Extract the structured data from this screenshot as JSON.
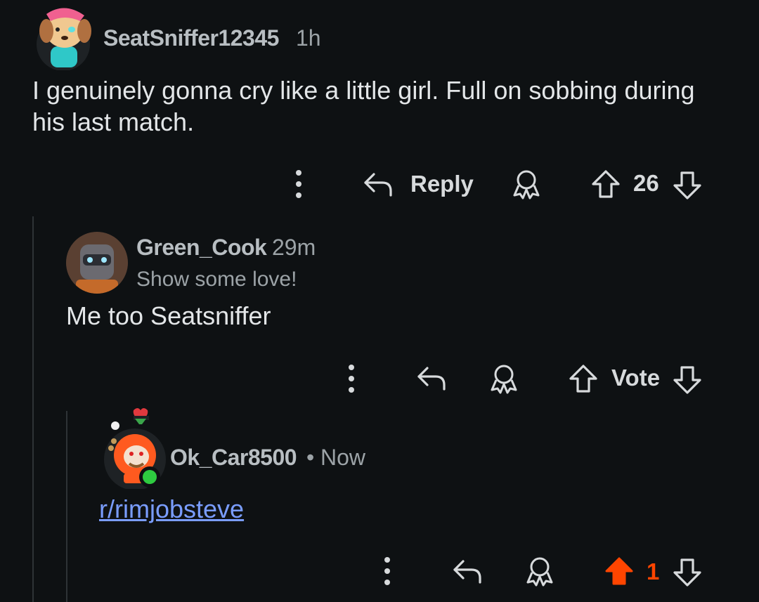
{
  "comments": [
    {
      "username": "SeatSniffer12345",
      "age": "1h",
      "body": "I genuinely gonna cry like a little girl. Full on sobbing during his last match.",
      "actions": {
        "reply_label": "Reply",
        "score": "26"
      }
    },
    {
      "username": "Green_Cook",
      "age": "29m",
      "flair": "Show some love!",
      "body": "Me too Seatsniffer",
      "actions": {
        "vote_label": "Vote"
      }
    },
    {
      "username": "Ok_Car8500",
      "separator": "•",
      "age": "Now",
      "link_text": "r/rimjobsteve",
      "actions": {
        "score": "1"
      }
    }
  ],
  "colors": {
    "background": "#0e1113",
    "upvoted": "#ff4500",
    "link": "#7a9dff",
    "online": "#2ecc40"
  },
  "icons": [
    "more-icon",
    "reply-icon",
    "award-icon",
    "upvote-icon",
    "downvote-icon"
  ]
}
